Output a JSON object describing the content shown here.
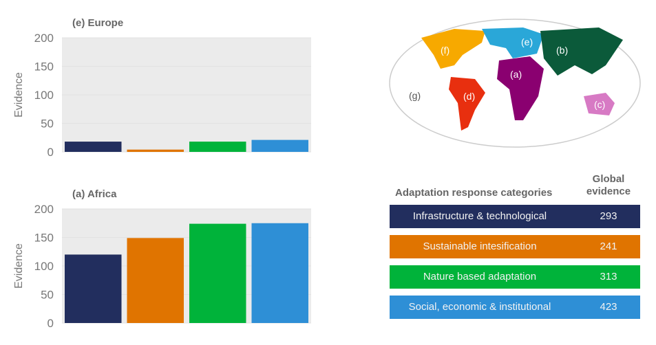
{
  "chart_data": [
    {
      "type": "bar",
      "title": "(e) Europe",
      "ylabel": "Evidence",
      "ylim": [
        0,
        200
      ],
      "yticks": [
        0,
        50,
        100,
        150,
        200
      ],
      "grid": true,
      "categories": [
        "Infrastructure & technological",
        "Sustainable intesification",
        "Nature based adaptation",
        "Social, economic & institutional"
      ],
      "values": [
        18,
        4,
        18,
        21
      ]
    },
    {
      "type": "bar",
      "title": "(a) Africa",
      "ylabel": "Evidence",
      "ylim": [
        0,
        200
      ],
      "yticks": [
        0,
        50,
        100,
        150,
        200
      ],
      "grid": true,
      "categories": [
        "Infrastructure & technological",
        "Sustainable intesification",
        "Nature based adaptation",
        "Social, economic & institutional"
      ],
      "values": [
        120,
        149,
        174,
        175
      ]
    },
    {
      "type": "table",
      "header": [
        "Adaptation response categories",
        "Global evidence"
      ],
      "rows": [
        {
          "label": "Infrastructure & technological",
          "value": "293",
          "color": "#222e5e"
        },
        {
          "label": "Sustainable intesification",
          "value": "241",
          "color": "#e07400"
        },
        {
          "label": "Nature based adaptation",
          "value": "313",
          "color": "#00b33a"
        },
        {
          "label": "Social, economic & institutional",
          "value": "423",
          "color": "#2e8fd6"
        }
      ]
    }
  ],
  "colors": [
    "#222e5e",
    "#e07400",
    "#00b33a",
    "#2e8fd6"
  ],
  "map": {
    "labels": [
      "(a)",
      "(b)",
      "(c)",
      "(d)",
      "(e)",
      "(f)",
      "(g)"
    ]
  }
}
